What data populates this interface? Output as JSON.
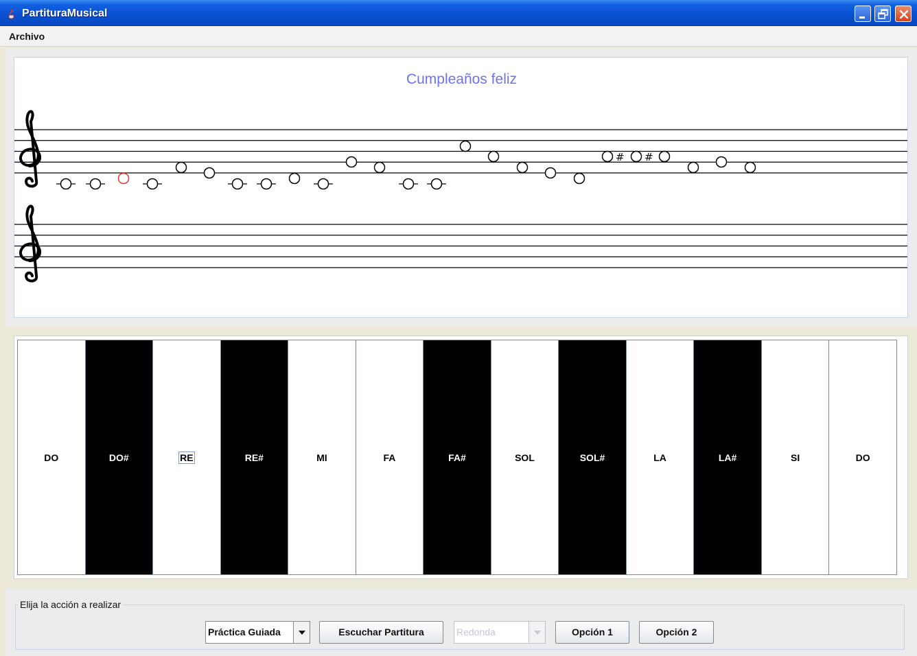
{
  "window": {
    "title": "PartituraMusical",
    "minimize": "minimize",
    "maximize": "maximize",
    "close": "close"
  },
  "menu": {
    "items": [
      "Archivo"
    ]
  },
  "score": {
    "title": "Cumpleaños feliz",
    "title_color": "#6e72f0",
    "highlight_color": "#e53935",
    "clef": "treble-clef",
    "sharp_symbol": "#"
  },
  "keyboard": {
    "keys": [
      {
        "label": "DO",
        "color": "white"
      },
      {
        "label": "DO#",
        "color": "black"
      },
      {
        "label": "RE",
        "color": "white",
        "focused": true
      },
      {
        "label": "RE#",
        "color": "black"
      },
      {
        "label": "MI",
        "color": "white"
      },
      {
        "label": "FA",
        "color": "white"
      },
      {
        "label": "FA#",
        "color": "black"
      },
      {
        "label": "SOL",
        "color": "white"
      },
      {
        "label": "SOL#",
        "color": "black"
      },
      {
        "label": "LA",
        "color": "white"
      },
      {
        "label": "LA#",
        "color": "black"
      },
      {
        "label": "SI",
        "color": "white"
      },
      {
        "label": "DO",
        "color": "white"
      }
    ]
  },
  "actions": {
    "legend": "Elija la acción a realizar",
    "mode_value": "Práctica Guiada",
    "play_button": "Escuchar Partitura",
    "duration_value": "Redonda",
    "option1_button": "Opción 1",
    "option2_button": "Opción 2"
  }
}
